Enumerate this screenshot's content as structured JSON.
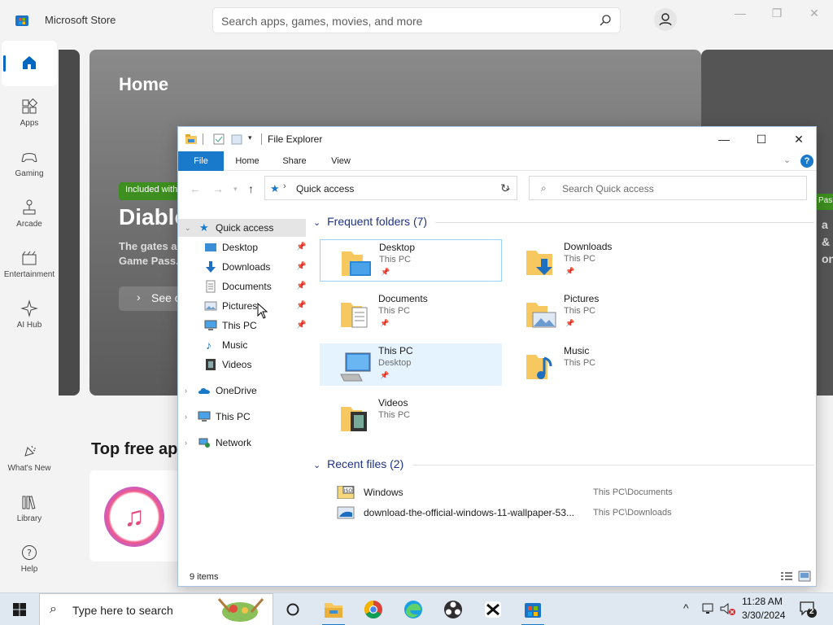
{
  "store": {
    "title": "Microsoft Store",
    "search_placeholder": "Search apps, games, movies, and more",
    "nav": [
      {
        "label": "",
        "icon": "home-icon"
      },
      {
        "label": "Apps",
        "icon": "apps-icon"
      },
      {
        "label": "Gaming",
        "icon": "gaming-icon"
      },
      {
        "label": "Arcade",
        "icon": "arcade-icon"
      },
      {
        "label": "Entertainment",
        "icon": "entertainment-icon"
      },
      {
        "label": "AI Hub",
        "icon": "ai-hub-icon"
      },
      {
        "label": "What's New",
        "icon": "whats-new-icon"
      },
      {
        "label": "Library",
        "icon": "library-icon"
      },
      {
        "label": "Help",
        "icon": "help-icon"
      }
    ],
    "hero": {
      "title": "Home",
      "badge": "Included with",
      "game": "Diablo",
      "desc1": "The gates a",
      "desc2": "Game Pass.",
      "see_button": "See o",
      "right_badge": "Pas",
      "right_text1": "a &",
      "right_text2": "on"
    },
    "section_title": "Top free app",
    "accent": "#0067c0"
  },
  "explorer": {
    "title": "File Explorer",
    "ribbon_tabs": [
      "File",
      "Home",
      "Share",
      "View"
    ],
    "address": "Quick access",
    "search_placeholder": "Search Quick access",
    "nav_tree": {
      "quick_access": "Quick access",
      "pinned": [
        "Desktop",
        "Downloads",
        "Documents",
        "Pictures",
        "This PC"
      ],
      "unpinned": [
        "Music",
        "Videos"
      ],
      "onedrive": "OneDrive",
      "this_pc": "This PC",
      "network": "Network"
    },
    "frequent_header": "Frequent folders (7)",
    "folders": [
      {
        "name": "Desktop",
        "location": "This PC",
        "pinned": true
      },
      {
        "name": "Downloads",
        "location": "This PC",
        "pinned": true
      },
      {
        "name": "Documents",
        "location": "This PC",
        "pinned": true
      },
      {
        "name": "Pictures",
        "location": "This PC",
        "pinned": true
      },
      {
        "name": "This PC",
        "location": "Desktop",
        "pinned": true
      },
      {
        "name": "Music",
        "location": "This PC",
        "pinned": false
      },
      {
        "name": "Videos",
        "location": "This PC",
        "pinned": false
      }
    ],
    "recent_header": "Recent files (2)",
    "recent_files": [
      {
        "name": "Windows",
        "location": "This PC\\Documents"
      },
      {
        "name": "download-the-official-windows-11-wallpaper-53...",
        "location": "This PC\\Downloads"
      }
    ],
    "status": "9 items",
    "accent": "#1979ca"
  },
  "taskbar": {
    "search_placeholder": "Type here to search",
    "time": "11:28 AM",
    "date": "3/30/2024",
    "notifications": "2"
  }
}
